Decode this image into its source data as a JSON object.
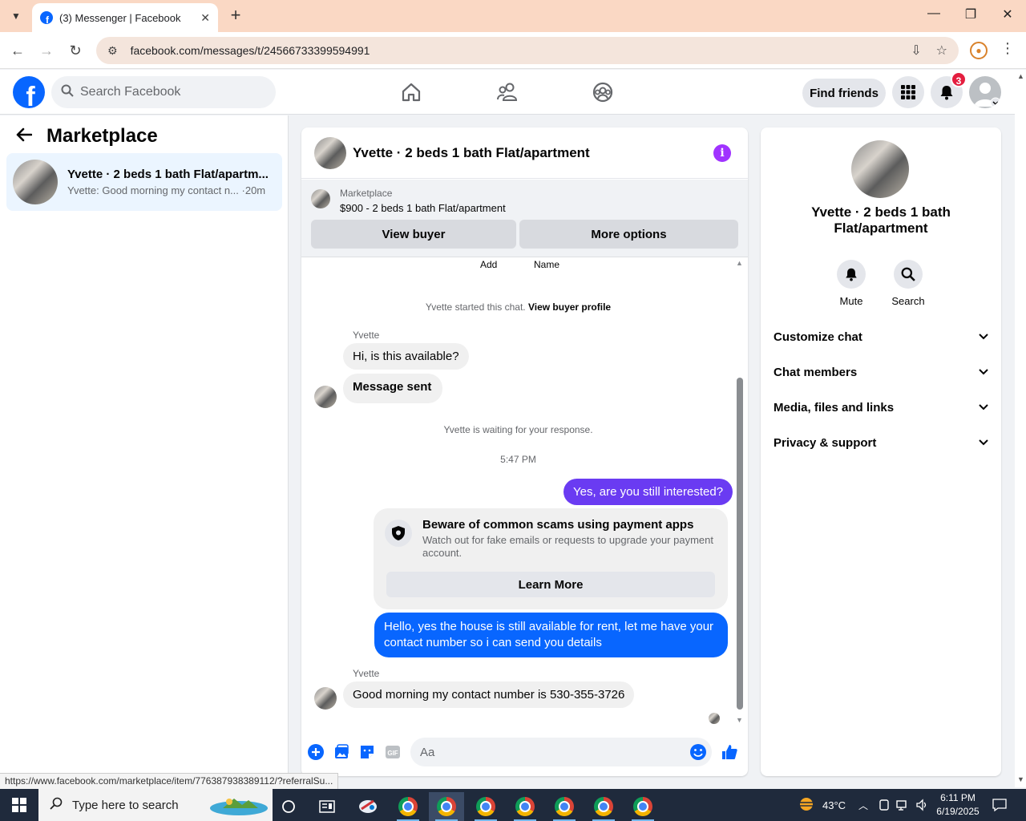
{
  "browser": {
    "tab_title": "(3) Messenger | Facebook",
    "url": "facebook.com/messages/t/24566733399594991",
    "status_link": "https://www.facebook.com/marketplace/item/776387938389112/?referralSu..."
  },
  "fbnav": {
    "logo": "f",
    "search_placeholder": "Search Facebook",
    "find_friends": "Find friends",
    "notification_count": "3"
  },
  "sidebar": {
    "title": "Marketplace",
    "conversation": {
      "title": "Yvette · 2 beds 1 bath Flat/apartm...",
      "preview": "Yvette: Good morning my contact n...",
      "time": "·20m"
    }
  },
  "chat": {
    "title": "Yvette · 2 beds 1 bath Flat/apartment",
    "marketplace_label": "Marketplace",
    "listing": "$900 - 2 beds 1 bath Flat/apartment",
    "view_buyer": "View buyer",
    "more_options": "More options",
    "cut_labels": [
      "Add",
      "Name"
    ],
    "started_text": "Yvette started this chat.",
    "view_buyer_profile": "View buyer profile",
    "sender_1": "Yvette",
    "msg_1": "Hi, is this available?",
    "msg_2": "Message sent",
    "waiting_text": "Yvette is waiting for your response.",
    "timestamp": "5:47 PM",
    "out_1": "Yes, are you still interested?",
    "scam_title": "Beware of common scams using payment apps",
    "scam_desc": "Watch out for fake emails or requests to upgrade your payment account.",
    "learn_more": "Learn More",
    "out_2": "Hello, yes the house is still available for rent, let me have your contact number so i can send you details",
    "sender_2": "Yvette",
    "msg_3": "Good morning my contact number is 530-355-3726",
    "composer_placeholder": "Aa"
  },
  "right_panel": {
    "name": "Yvette · 2 beds 1 bath Flat/apartment",
    "mute": "Mute",
    "search": "Search",
    "rows": [
      "Customize chat",
      "Chat members",
      "Media, files and links",
      "Privacy & support"
    ]
  },
  "taskbar": {
    "search_placeholder": "Type here to search",
    "temperature": "43°C",
    "time": "6:11 PM",
    "date": "6/19/2025"
  },
  "colors": {
    "fb_blue": "#0866ff",
    "out_bubble_purple": "#6a3bf2",
    "out_bubble_blue": "#0866ff",
    "badge_red": "#e41e3f",
    "info_purple": "#a033ff"
  }
}
